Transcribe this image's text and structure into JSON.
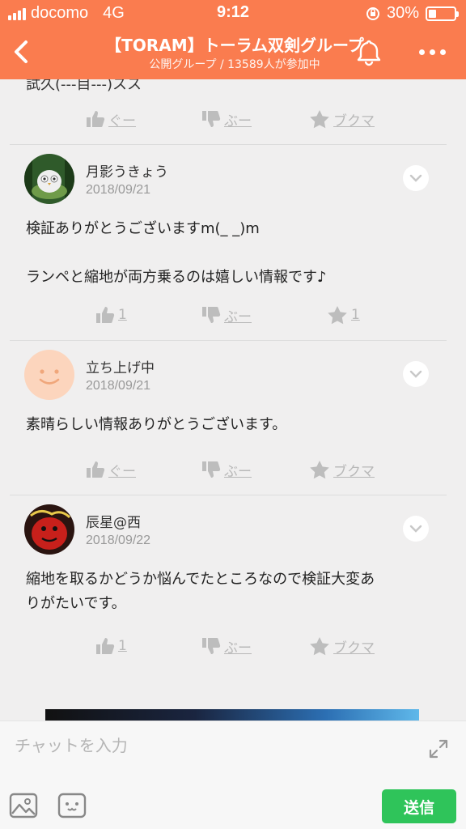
{
  "status_bar": {
    "carrier": "docomo",
    "network": "4G",
    "time": "9:12",
    "battery_percent": "30%",
    "battery_level": 0.3,
    "icons": [
      "signal-icon",
      "orientation-lock-icon",
      "battery-icon"
    ]
  },
  "nav": {
    "title": "【TORAM】トーラム双剣グループ",
    "subtitle": "公開グループ / 13589人が参加中",
    "accent_color": "#fa7c4f",
    "icons": [
      "back-arrow-icon",
      "bell-icon",
      "more-dots-icon"
    ]
  },
  "feed": {
    "previous_post": {
      "cut_text": "試久(---目---)スス",
      "actions": {
        "like": "ぐー",
        "dislike": "ぶー",
        "bookmark": "ブクマ"
      }
    },
    "posts": [
      {
        "author": "月影うきょう",
        "date": "2018/09/21",
        "body": [
          "検証ありがとうございますm(_ _)m",
          "",
          "ランペと縮地が両方乗るのは嬉しい情報です♪"
        ],
        "actions": {
          "like": "1",
          "dislike": "ぶー",
          "bookmark": "1"
        }
      },
      {
        "author": "立ち上げ中",
        "date": "2018/09/21",
        "body": [
          "素晴らしい情報ありがとうございます。"
        ],
        "actions": {
          "like": "ぐー",
          "dislike": "ぶー",
          "bookmark": "ブクマ"
        }
      },
      {
        "author": "辰星@西",
        "date": "2018/09/22",
        "body": [
          "縮地を取るかどうか悩んでたところなので検証大変あ",
          "りがたいです。"
        ],
        "actions": {
          "like": "1",
          "dislike": "ぶー",
          "bookmark": "ブクマ"
        }
      }
    ]
  },
  "composer": {
    "placeholder": "チャットを入力",
    "send_label": "送信",
    "send_color": "#2fc45a",
    "icons": [
      "expand-icon",
      "image-icon",
      "emoji-icon"
    ]
  }
}
